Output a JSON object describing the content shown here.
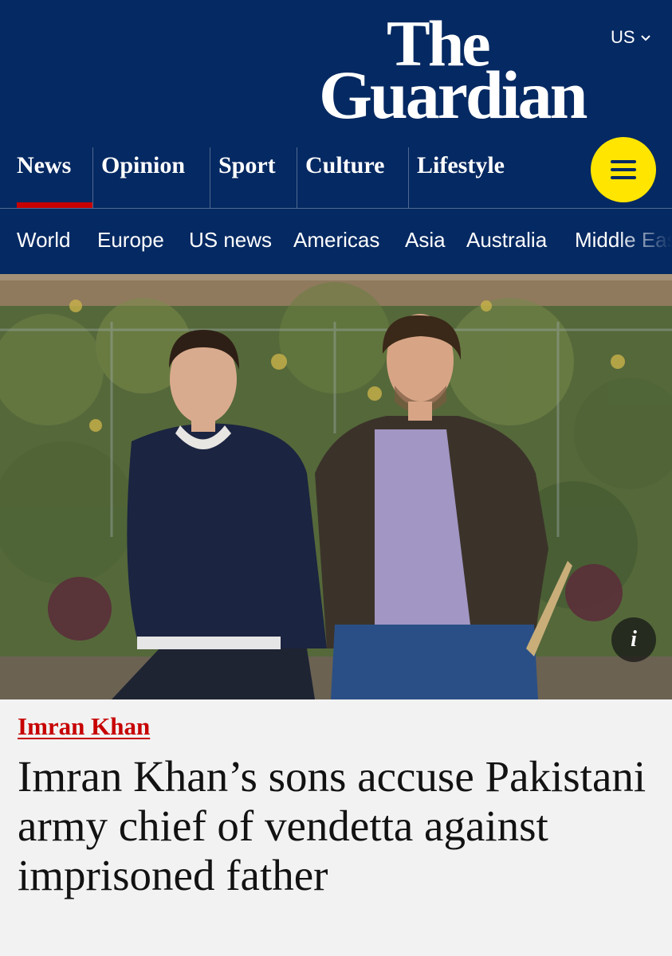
{
  "header": {
    "edition": "US",
    "logo_line1": "The",
    "logo_line2": "Guardian",
    "pillars": [
      {
        "label": "News",
        "active": true
      },
      {
        "label": "Opinion",
        "active": false
      },
      {
        "label": "Sport",
        "active": false
      },
      {
        "label": "Culture",
        "active": false
      },
      {
        "label": "Lifestyle",
        "active": false
      }
    ],
    "menu_icon": "hamburger-icon"
  },
  "subnav": {
    "items": [
      "World",
      "Europe",
      "US news",
      "Americas",
      "Asia",
      "Australia",
      "Middle East"
    ]
  },
  "hero": {
    "info_icon": "i"
  },
  "article": {
    "kicker": "Imran Khan",
    "headline": "Imran Khan’s sons accuse Pakistani army chief of vendetta against imprisoned father"
  },
  "colors": {
    "brand_blue": "#052962",
    "accent_yellow": "#ffe500",
    "news_red": "#c70000",
    "background": "#f2f2f2"
  }
}
